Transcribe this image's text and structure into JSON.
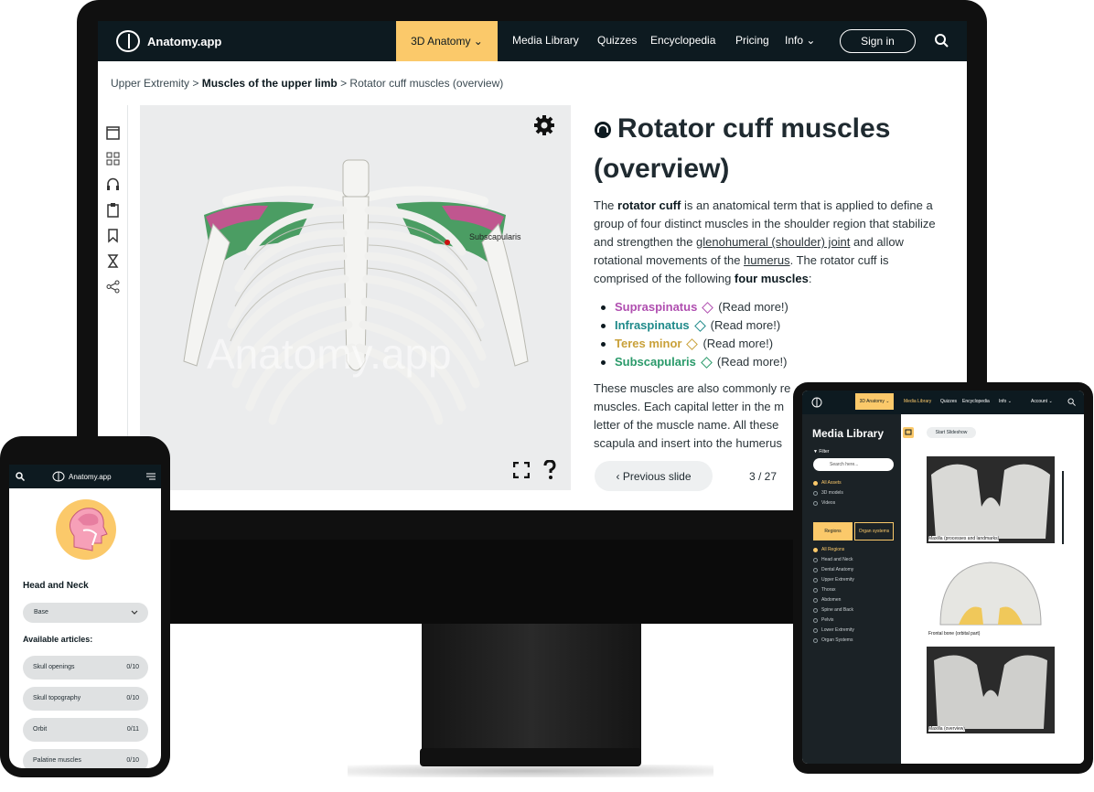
{
  "monitor": {
    "brand": "Anatomy.app",
    "nav": {
      "active_label": "3D Anatomy ⌄",
      "items": [
        "Media Library",
        "Quizzes",
        "Encyclopedia",
        "Pricing",
        "Info ⌄"
      ],
      "signin": "Sign in"
    },
    "breadcrumb": {
      "first": "Upper Extremity >",
      "second": "Muscles of the upper limb",
      "third": "> Rotator cuff muscles (overview)"
    },
    "viewer": {
      "label": "Subscapularis",
      "watermark": "Anatomy.app"
    },
    "article": {
      "title": "Rotator cuff muscles (overview)",
      "p1_a": "The ",
      "p1_b": "rotator cuff",
      "p1_c": " is an anatomical term that is applied to define a group of four distinct muscles in the shoulder region that stabilize and strengthen the ",
      "p1_d": "glenohumeral (shoulder) joint",
      "p1_e": " and allow rotational movements of the ",
      "p1_f": "humerus",
      "p1_g": ". The rotator cuff is comprised of the following ",
      "p1_h": "four muscles",
      "p1_i": ":",
      "muscles": [
        {
          "name": "Supraspinatus",
          "link": "(Read more!)",
          "color": "#b04fb0"
        },
        {
          "name": "Infraspinatus",
          "link": "(Read more!)",
          "color": "#1f8a8a"
        },
        {
          "name": "Teres minor",
          "link": "(Read more!)",
          "color": "#c9a13a"
        },
        {
          "name": "Subscapularis",
          "link": "(Read more!)",
          "color": "#2a9a6a"
        }
      ],
      "p2_a": "These muscles are also commonly re",
      "p2_b": "muscles. Each capital letter in the m",
      "p2_c": "letter of the muscle name. All these",
      "p2_d1": "scapula",
      "p2_d2": " and insert into the ",
      "p2_d3": "humerus"
    },
    "pager": {
      "prev": "‹  Previous slide",
      "count": "3 / 27"
    }
  },
  "tablet": {
    "nav_active": "3D Anatomy ⌄",
    "nav_items": [
      "Media Library",
      "Quizzes",
      "Encyclopedia",
      "Info ⌄",
      "Account ⌄"
    ],
    "title": "Media Library",
    "filter": "▼ Filter",
    "search_placeholder": "Search here...",
    "asset_options": [
      "All Assets",
      "3D models",
      "Videos"
    ],
    "tabs": [
      "Regions",
      "Organ systems"
    ],
    "region_options": [
      "All Regions",
      "Head and Neck",
      "Dental Anatomy",
      "Upper Extremity",
      "Thorax",
      "Abdomen",
      "Spine and Back",
      "Pelvis",
      "Lower Extremity",
      "Organ Systems"
    ],
    "slideshow": "Start Slideshow",
    "cards": [
      "Maxilla (processes and landmarks)",
      "Frontal bone (orbital part)",
      "Maxilla (overview)"
    ]
  },
  "phone": {
    "brand": "Anatomy.app",
    "heading": "Head and Neck",
    "select": "Base",
    "sub": "Available articles:",
    "rows": [
      {
        "label": "Skull openings",
        "count": "0/10"
      },
      {
        "label": "Skull topography",
        "count": "0/10"
      },
      {
        "label": "Orbit",
        "count": "0/11"
      },
      {
        "label": "Palatine muscles",
        "count": "0/10"
      }
    ]
  }
}
